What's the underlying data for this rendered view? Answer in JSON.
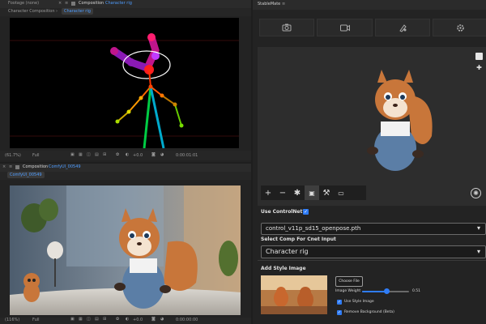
{
  "left_top": {
    "footage_tab": "Footage (none)",
    "comp_tab_prefix": "Composition",
    "comp_tab_name": "Character rig",
    "comp_subtab_label": "Character Composition",
    "comp_subtab_active": "Character rig",
    "zoom": "(61.7%)",
    "resolution": "Full",
    "offset": "+0.0",
    "timecode": "0:00:01:01"
  },
  "left_bottom": {
    "comp_tab_prefix": "Composition",
    "comp_tab_name": "ComfyUI_00549",
    "comp_subtab_active": "ComfyUI_00549",
    "zoom": "(116%)",
    "resolution": "Full",
    "offset": "+0.0",
    "timecode": "0:00:00:00"
  },
  "right": {
    "panel_title": "StableMate",
    "toolbar_icons": [
      "camera-icon",
      "video-icon",
      "paint-icon",
      "settings-gear-icon"
    ],
    "use_controlnet_label": "Use ControlNet?",
    "use_controlnet_checked": true,
    "controlnet_model": "control_v11p_sd15_openpose.pth",
    "select_comp_label": "Select Comp For Cnet Input",
    "selected_comp": "Character rig",
    "add_style_label": "Add Style Image",
    "choose_file_label": "Choose File",
    "image_weight_label": "Image Weight",
    "image_weight_value": "0.51",
    "image_weight_fraction": 0.51,
    "use_style_image_label": "Use Style Image",
    "use_style_image_checked": true,
    "remove_bg_label": "Remove Background (Beta)",
    "remove_bg_checked": true
  }
}
